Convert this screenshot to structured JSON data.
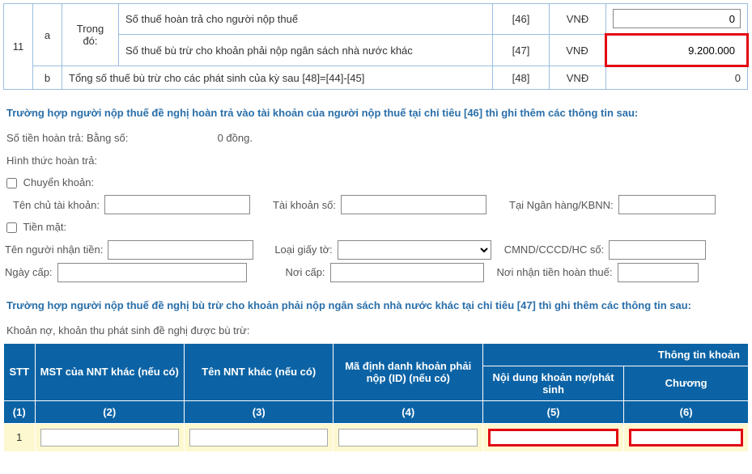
{
  "top_table": {
    "row1": {
      "num": "11",
      "letter": "a",
      "label": "Trong đó:",
      "desc": "Số thuế hoàn trả cho người nộp thuế",
      "code": "[46]",
      "unit": "VNĐ",
      "value": "0"
    },
    "row2": {
      "desc": "Số thuế bù trừ cho khoản phải nộp ngân sách nhà nước khác",
      "code": "[47]",
      "unit": "VNĐ",
      "value": "9.200.000"
    },
    "row3": {
      "letter": "b",
      "desc": "Tổng số thuế bù trừ cho các phát sinh của kỳ sau [48]=[44]-[45]",
      "code": "[48]",
      "unit": "VNĐ",
      "value": "0"
    }
  },
  "section1_title": "Trường hợp người nộp thuế đề nghị hoàn trả vào tài khoản của người nộp thuế tại chỉ tiêu  [46] thì ghi thêm các thông tin sau:",
  "refund": {
    "amount_label": "Số tiền hoàn trả: Bằng số:",
    "amount_value": "0 đồng.",
    "method_label": "Hình thức hoàn trả:",
    "transfer_label": "Chuyển khoản:",
    "acc_holder_label": "Tên chủ tài khoản:",
    "acc_no_label": "Tài khoản số:",
    "bank_label": "Tại Ngân hàng/KBNN:",
    "cash_label": "Tiền mặt:",
    "recipient_label": "Tên người nhận tiền:",
    "id_type_label": "Loại giấy tờ:",
    "id_no_label": "CMND/CCCD/HC số:",
    "issued_date_label": "Ngày cấp:",
    "issued_place_label": "Nơi cấp:",
    "refund_place_label": "Nơi nhận tiền hoàn thuế:"
  },
  "section2_title": "Trường hợp người nộp thuế đề nghị bù trừ cho khoản phải nộp ngân sách nhà nước khác tại chỉ tiêu [47] thì ghi thêm các thông tin sau:",
  "sub2": "Khoản nợ, khoản thu phát sinh đề nghị được bù trừ:",
  "btable": {
    "group_head": "Thông tin khoản",
    "h_stt": "STT",
    "h2": "MST của NNT khác (nếu có)",
    "h3": "Tên NNT khác (nếu có)",
    "h4": "Mã định danh khoản phải nộp (ID) (nếu có)",
    "h5": "Nội dung khoản nợ/phát sinh",
    "h6": "Chương",
    "n1": "(1)",
    "n2": "(2)",
    "n3": "(3)",
    "n4": "(4)",
    "n5": "(5)",
    "n6": "(6)",
    "row1_stt": "1"
  }
}
